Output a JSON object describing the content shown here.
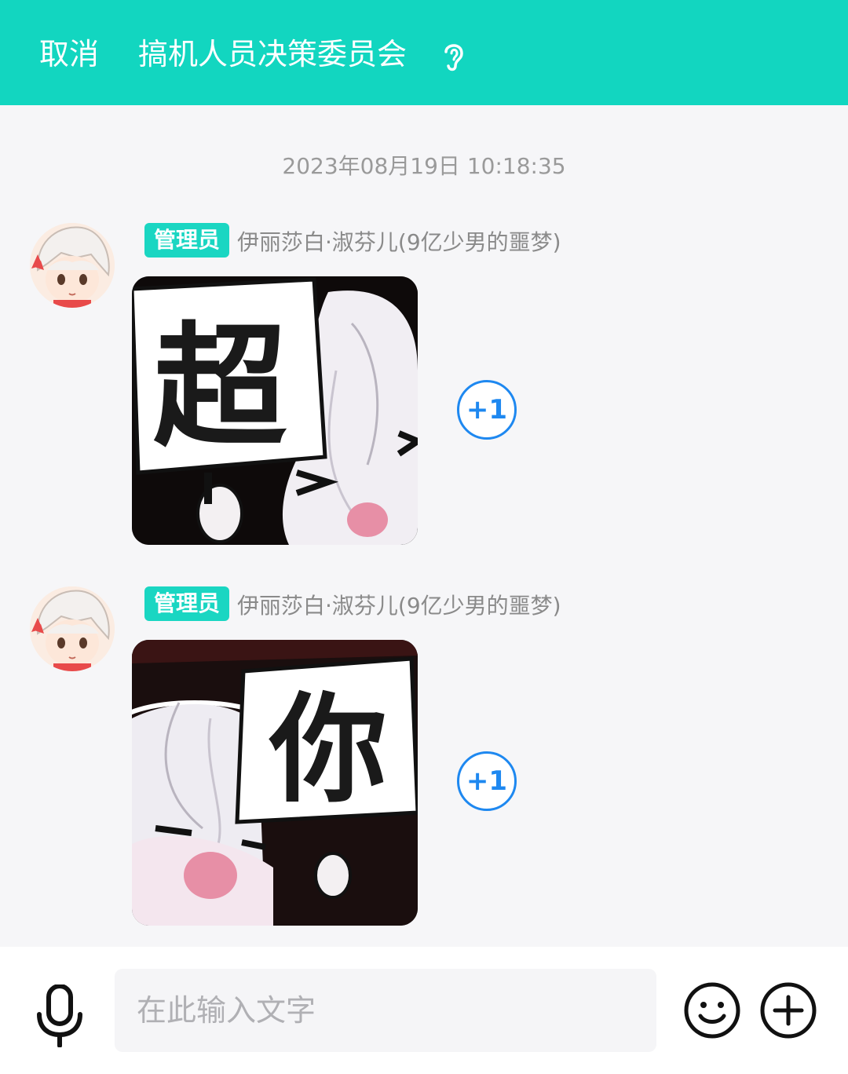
{
  "header": {
    "cancel_label": "取消",
    "title": "搞机人员决策委员会",
    "ear_icon": "ear-icon",
    "background_color": "#12d6c0"
  },
  "chat": {
    "timestamp": "2023年08月19日 10:18:35",
    "messages": [
      {
        "role_badge": "管理员",
        "sender": "伊丽莎白·淑芬儿(9亿少男的噩梦)",
        "sticker_text": "超",
        "reaction": "+1"
      },
      {
        "role_badge": "管理员",
        "sender": "伊丽莎白·淑芬儿(9亿少男的噩梦)",
        "sticker_text": "你",
        "reaction": "+1"
      }
    ]
  },
  "input_bar": {
    "placeholder": "在此输入文字",
    "mic_icon": "microphone-icon",
    "emoji_icon": "smiley-icon",
    "plus_icon": "plus-circle-icon"
  },
  "colors": {
    "accent": "#12d6c0",
    "badge": "#1ad6c2",
    "reaction": "#1e88f0"
  }
}
